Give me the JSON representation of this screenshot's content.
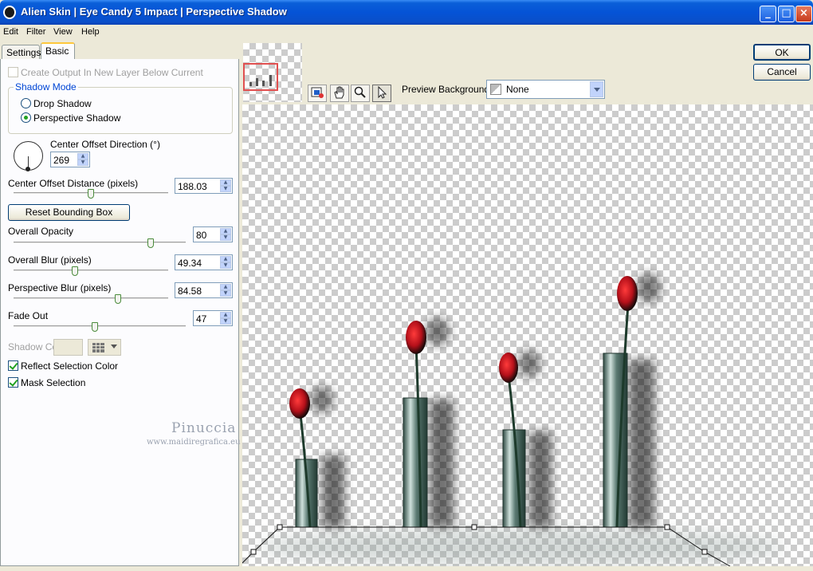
{
  "window": {
    "title": "Alien Skin | Eye Candy 5 Impact | Perspective Shadow",
    "minimize": "_",
    "maximize": "□",
    "close": "×"
  },
  "menu": [
    "Edit",
    "Filter",
    "View",
    "Help"
  ],
  "tabs": [
    "Settings",
    "Basic"
  ],
  "basic": {
    "create_output_label": "Create Output In New Layer Below Current",
    "shadow_mode_title": "Shadow Mode",
    "drop_shadow": "Drop Shadow",
    "perspective_shadow": "Perspective Shadow",
    "selected_mode": "Perspective Shadow",
    "center_offset_direction_label": "Center Offset Direction (°)",
    "center_offset_direction_value": "269",
    "center_offset_distance_label": "Center Offset Distance (pixels)",
    "center_offset_distance_value": "188.03",
    "reset_bounding_box": "Reset Bounding Box",
    "overall_opacity_label": "Overall Opacity",
    "overall_opacity_value": "80",
    "overall_blur_label": "Overall Blur (pixels)",
    "overall_blur_value": "49.34",
    "perspective_blur_label": "Perspective Blur (pixels)",
    "perspective_blur_value": "84.58",
    "fade_out_label": "Fade Out",
    "fade_out_value": "47",
    "shadow_color_label": "Shadow Color",
    "reflect_selection_color": "Reflect Selection Color",
    "mask_selection": "Mask Selection",
    "reflect_checked": true,
    "mask_checked": true
  },
  "watermark": {
    "name": "Pinuccia",
    "url": "www.maidiregrafica.eu"
  },
  "preview_toolbar": {
    "background_label": "Preview Background:",
    "background_value": "None"
  },
  "buttons": {
    "ok": "OK",
    "cancel": "Cancel"
  },
  "colors": {
    "titlebar": "#0553d6",
    "accent_green": "#21a121",
    "group_title": "#0046d5"
  }
}
